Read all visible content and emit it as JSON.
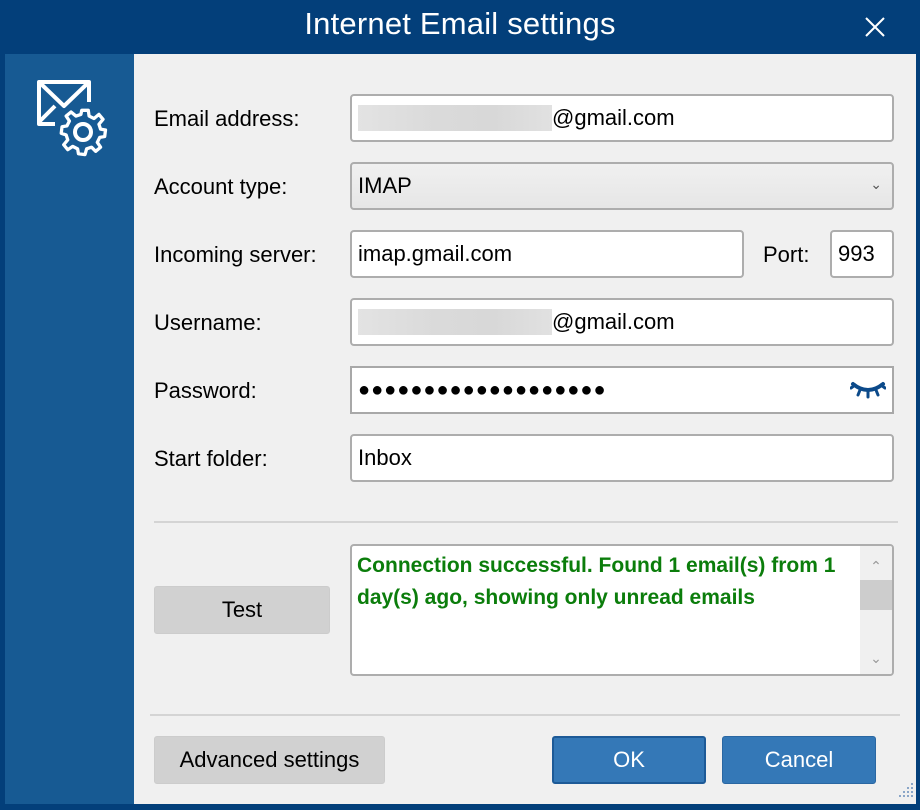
{
  "window": {
    "title": "Internet Email settings",
    "close_icon": "close-icon",
    "sidebar_icon": "email-settings-gear-icon"
  },
  "form": {
    "email_address": {
      "label": "Email address:",
      "value_suffix": "@gmail.com",
      "value_prefix_redacted": true
    },
    "account_type": {
      "label": "Account type:",
      "value": "IMAP",
      "icon": "chevron-down-icon"
    },
    "incoming_server": {
      "label": "Incoming server:",
      "value": "imap.gmail.com"
    },
    "port": {
      "label": "Port:",
      "value": "993"
    },
    "username": {
      "label": "Username:",
      "value_suffix": "@gmail.com",
      "value_prefix_redacted": true
    },
    "password": {
      "label": "Password:",
      "masked_value": "●●●●●●●●●●●●●●●●●●●",
      "icon": "eye-closed-icon"
    },
    "start_folder": {
      "label": "Start folder:",
      "value": "Inbox"
    }
  },
  "test": {
    "button_label": "Test",
    "result_text": "Connection successful. Found 1 email(s) from 1 day(s) ago, showing only unread emails",
    "result_color": "#0b7d0b"
  },
  "footer": {
    "advanced_label": "Advanced settings",
    "ok_label": "OK",
    "cancel_label": "Cancel"
  },
  "colors": {
    "titlebar": "#033f7a",
    "sidebar": "#175a93",
    "primary_button": "#3478b7",
    "eye_icon": "#0c4a8a"
  }
}
